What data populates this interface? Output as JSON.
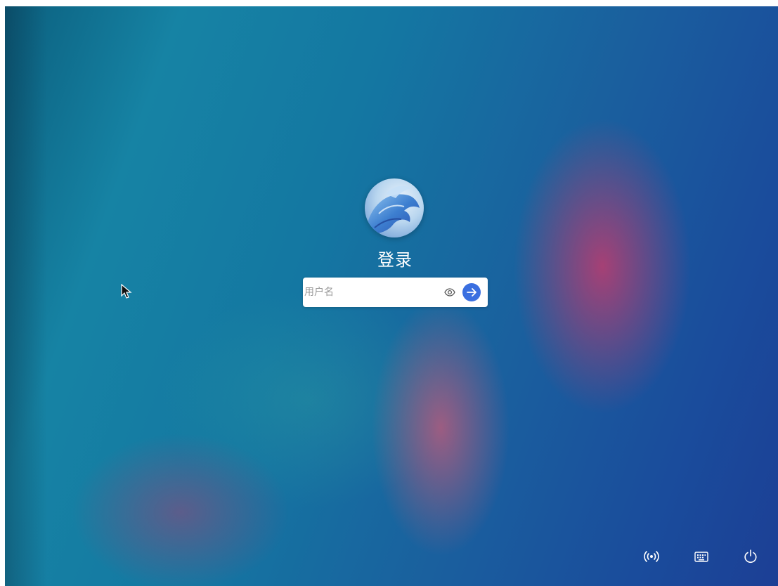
{
  "login": {
    "title": "登录",
    "username_placeholder": "用户名",
    "username_value": ""
  },
  "icons": {
    "avatar": "dragon-avatar-icon",
    "password_visibility": "eye-icon",
    "submit": "arrow-right-icon",
    "network": "wireless-signal-icon",
    "keyboard": "keyboard-icon",
    "power": "power-icon",
    "cursor": "mouse-pointer-icon"
  },
  "colors": {
    "accent": "#3a6fe0",
    "input_background": "#ffffff",
    "text": "#ffffff"
  }
}
